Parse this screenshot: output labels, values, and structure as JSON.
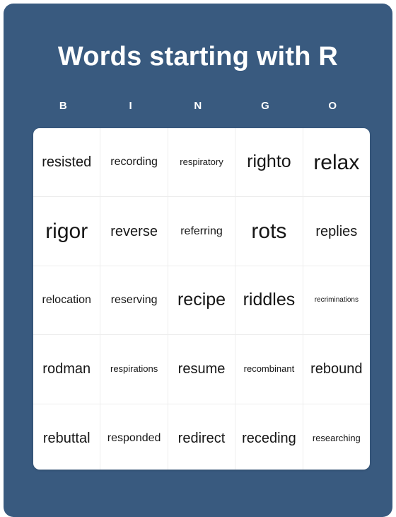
{
  "card": {
    "title": "Words starting with R",
    "background_color": "#395a7f",
    "grid_background_color": "#ffffff",
    "title_color": "#ffffff",
    "cell_text_color": "#161616",
    "divider_color": "#ededed"
  },
  "header": {
    "letters": [
      "B",
      "I",
      "N",
      "G",
      "O"
    ]
  },
  "grid": {
    "rows": [
      [
        {
          "word": "resisted",
          "size": "fs-md"
        },
        {
          "word": "recording",
          "size": "fs-sm"
        },
        {
          "word": "respiratory",
          "size": "fs-xs"
        },
        {
          "word": "righto",
          "size": "fs-lg"
        },
        {
          "word": "relax",
          "size": "fs-xl"
        }
      ],
      [
        {
          "word": "rigor",
          "size": "fs-xl"
        },
        {
          "word": "reverse",
          "size": "fs-md"
        },
        {
          "word": "referring",
          "size": "fs-sm"
        },
        {
          "word": "rots",
          "size": "fs-xl"
        },
        {
          "word": "replies",
          "size": "fs-md"
        }
      ],
      [
        {
          "word": "relocation",
          "size": "fs-sm"
        },
        {
          "word": "reserving",
          "size": "fs-sm"
        },
        {
          "word": "recipe",
          "size": "fs-lg"
        },
        {
          "word": "riddles",
          "size": "fs-lg"
        },
        {
          "word": "recriminations",
          "size": "fs-xxs"
        }
      ],
      [
        {
          "word": "rodman",
          "size": "fs-md"
        },
        {
          "word": "respirations",
          "size": "fs-xs"
        },
        {
          "word": "resume",
          "size": "fs-md"
        },
        {
          "word": "recombinant",
          "size": "fs-xs"
        },
        {
          "word": "rebound",
          "size": "fs-md"
        }
      ],
      [
        {
          "word": "rebuttal",
          "size": "fs-md"
        },
        {
          "word": "responded",
          "size": "fs-sm"
        },
        {
          "word": "redirect",
          "size": "fs-md"
        },
        {
          "word": "receding",
          "size": "fs-md"
        },
        {
          "word": "researching",
          "size": "fs-xs"
        }
      ]
    ]
  }
}
